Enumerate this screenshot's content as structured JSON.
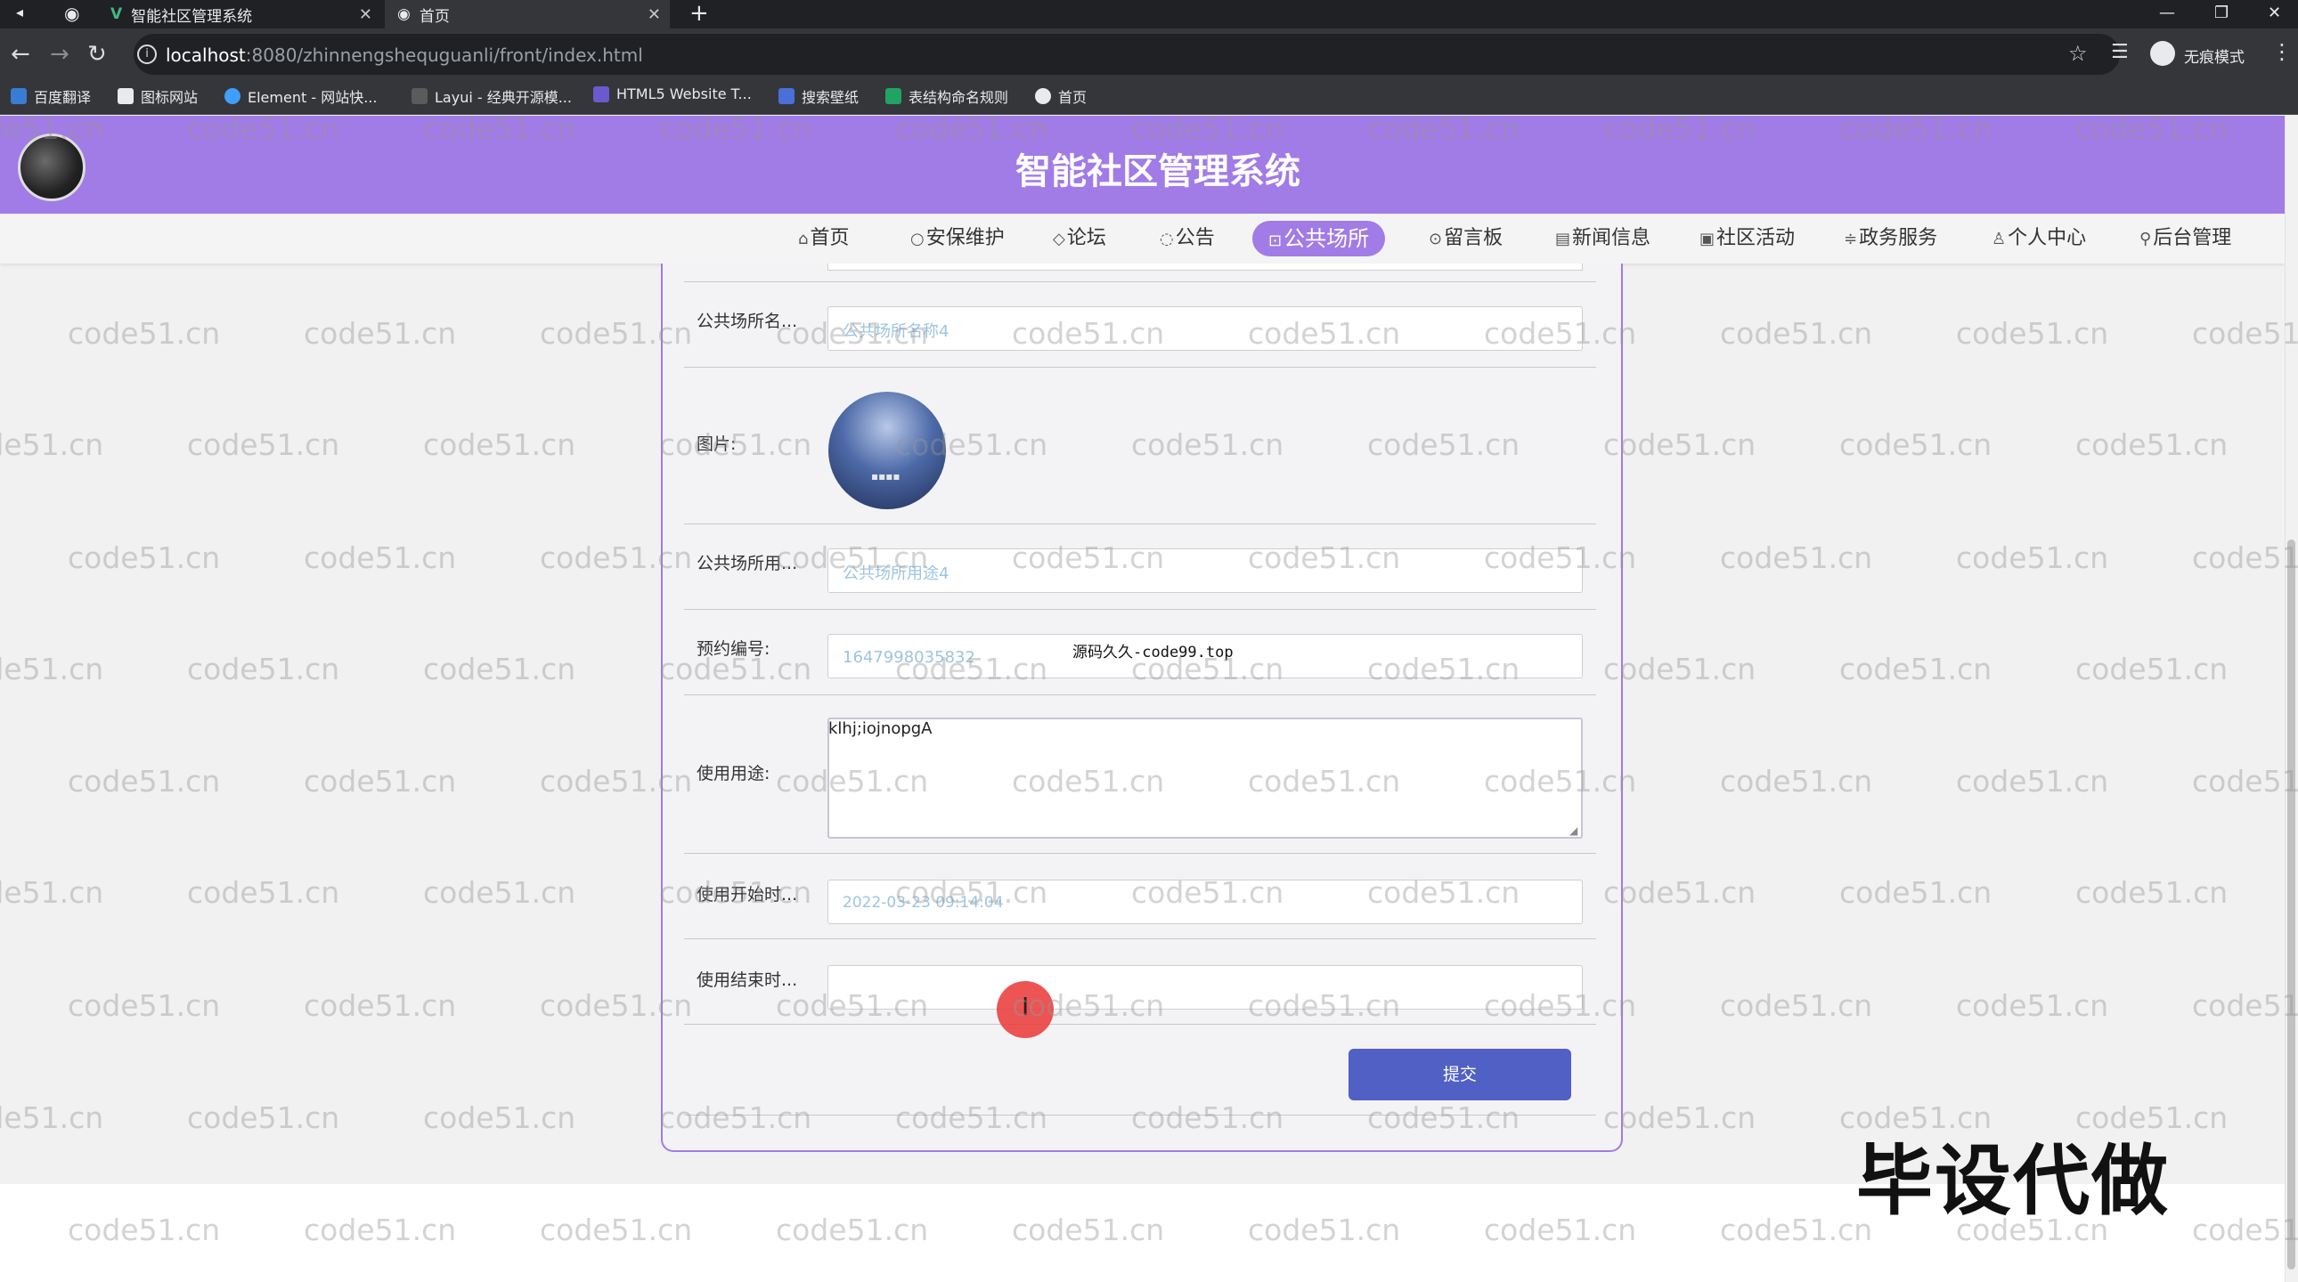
{
  "browser": {
    "tabs": [
      {
        "title": "智能社区管理系统",
        "active": false
      },
      {
        "title": "首页",
        "active": true
      }
    ],
    "new_tab": "+",
    "url_host": "localhost",
    "url_rest": ":8080/zhinnengshequguanli/front/index.html",
    "incognito_label": "无痕模式",
    "bookmarks": [
      "百度翻译",
      "图标网站",
      "Element - 网站快...",
      "Layui - 经典开源模...",
      "HTML5 Website T...",
      "搜索壁纸",
      "表结构命名规则",
      "首页"
    ]
  },
  "site": {
    "title": "智能社区管理系统",
    "nav": [
      "首页",
      "安保维护",
      "论坛",
      "公告",
      "公共场所",
      "留言板",
      "新闻信息",
      "社区活动",
      "政务服务",
      "个人中心",
      "后台管理"
    ],
    "active_nav": "公共场所"
  },
  "form": {
    "name_label": "公共场所名...",
    "name_placeholder": "公共场所名称4",
    "image_label": "图片:",
    "usage_label": "公共场所用...",
    "usage_placeholder": "公共场所用途4",
    "booking_label": "预约编号:",
    "booking_value": "1647998035832",
    "purpose_label": "使用用途:",
    "purpose_value": "klhj;iojnopgA",
    "start_label": "使用开始时...",
    "start_value": "2022-03-23 09:14:04",
    "end_label": "使用结束时...",
    "end_value": "",
    "submit_label": "提交"
  },
  "overlay": {
    "source_note": "源码久久-code99.top",
    "stamp": "毕设代做",
    "watermark": "code51.cn"
  }
}
